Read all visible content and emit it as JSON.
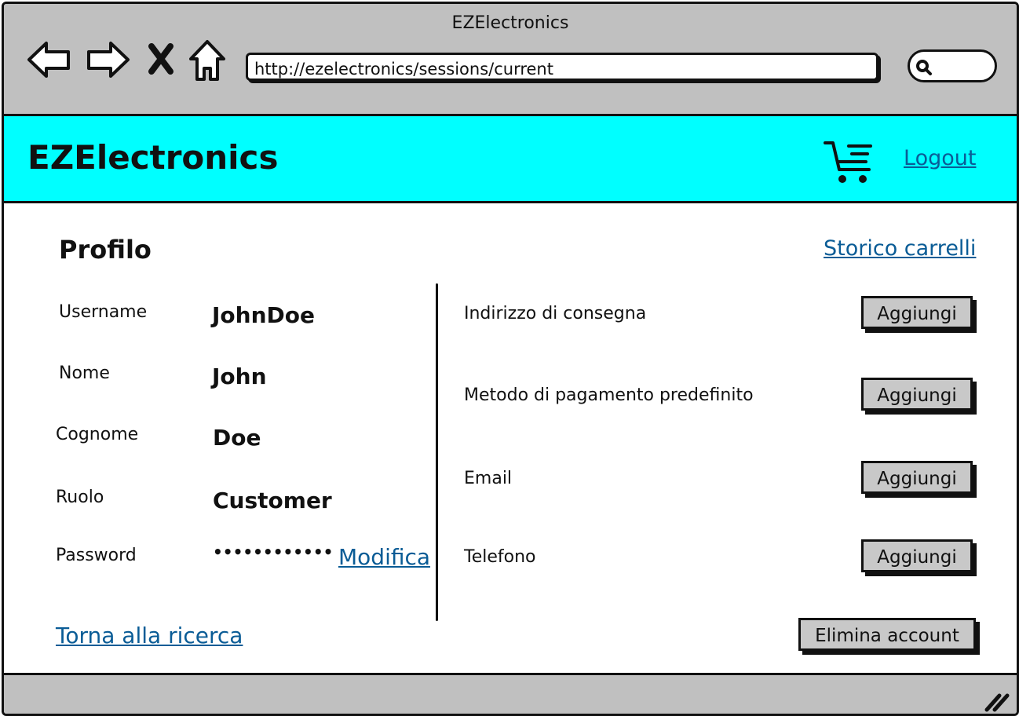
{
  "window": {
    "title": "EZElectronics",
    "url": "http://ezelectronics/sessions/current",
    "nav_icons": [
      "back-icon",
      "forward-icon",
      "close-icon",
      "home-icon",
      "search-icon",
      "resize-grip-icon"
    ]
  },
  "header": {
    "brand": "EZElectronics",
    "cart_icon": "cart-icon",
    "logout_label": "Logout",
    "background_color": "#00ffff"
  },
  "profile": {
    "title": "Profilo",
    "history_link": "Storico carrelli",
    "fields": {
      "username": {
        "label": "Username",
        "value": "JohnDoe"
      },
      "name": {
        "label": "Nome",
        "value": "John"
      },
      "surname": {
        "label": "Cognome",
        "value": "Doe"
      },
      "role": {
        "label": "Ruolo",
        "value": "Customer"
      },
      "password": {
        "label": "Password",
        "value": "••••••••••••",
        "edit_label": "Modifica"
      }
    },
    "extra": {
      "address": {
        "label": "Indirizzo di consegna",
        "button": "Aggiungi"
      },
      "payment": {
        "label": "Metodo di pagamento predefinito",
        "button": "Aggiungi"
      },
      "email": {
        "label": "Email",
        "button": "Aggiungi"
      },
      "phone": {
        "label": "Telefono",
        "button": "Aggiungi"
      }
    },
    "back_link": "Torna alla ricerca",
    "delete_button": "Elimina account"
  },
  "colors": {
    "link": "#0a5c96",
    "chrome": "#c0c0c0",
    "button": "#c8c8c8"
  }
}
